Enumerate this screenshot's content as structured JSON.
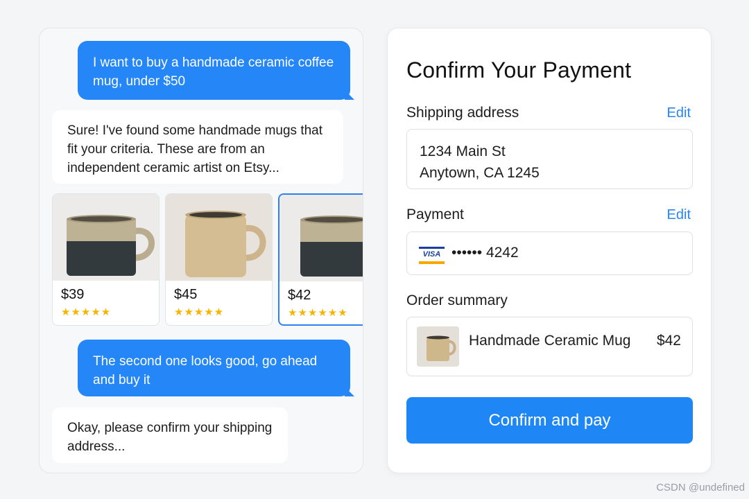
{
  "chat": {
    "messages": [
      {
        "role": "user",
        "text": "I want to buy a handmade ceramic coffee mug, under $50"
      },
      {
        "role": "assistant",
        "text": "Sure! I've found some handmade mugs that fit your criteria. These are from an independent ceramic artist on Etsy..."
      },
      {
        "role": "user",
        "text": "The second one looks good, go ahead and buy it"
      },
      {
        "role": "assistant",
        "text": "Okay, please confirm your shipping address..."
      }
    ],
    "products": [
      {
        "price": "$39",
        "stars": "★★★★★",
        "rating": 5,
        "selected": false
      },
      {
        "price": "$45",
        "stars": "★★★★★",
        "rating": 5,
        "selected": false
      },
      {
        "price": "$42",
        "stars": "★★★★★★",
        "rating": 5,
        "selected": true
      }
    ]
  },
  "payment": {
    "title": "Confirm Your Payment",
    "shipping": {
      "label": "Shipping address",
      "edit_label": "Edit",
      "line1": "1234 Main St",
      "line2": "Anytown, CA 1245"
    },
    "method": {
      "label": "Payment",
      "edit_label": "Edit",
      "card_brand": "VISA",
      "card_number": "•••••• 4242"
    },
    "summary": {
      "label": "Order summary",
      "item_name": "Handmade Ceramic Mug",
      "item_price": "$42"
    },
    "confirm_label": "Confirm and pay"
  },
  "watermark": "CSDN @undefined",
  "colors": {
    "accent": "#2486f7",
    "star": "#f7b500"
  }
}
